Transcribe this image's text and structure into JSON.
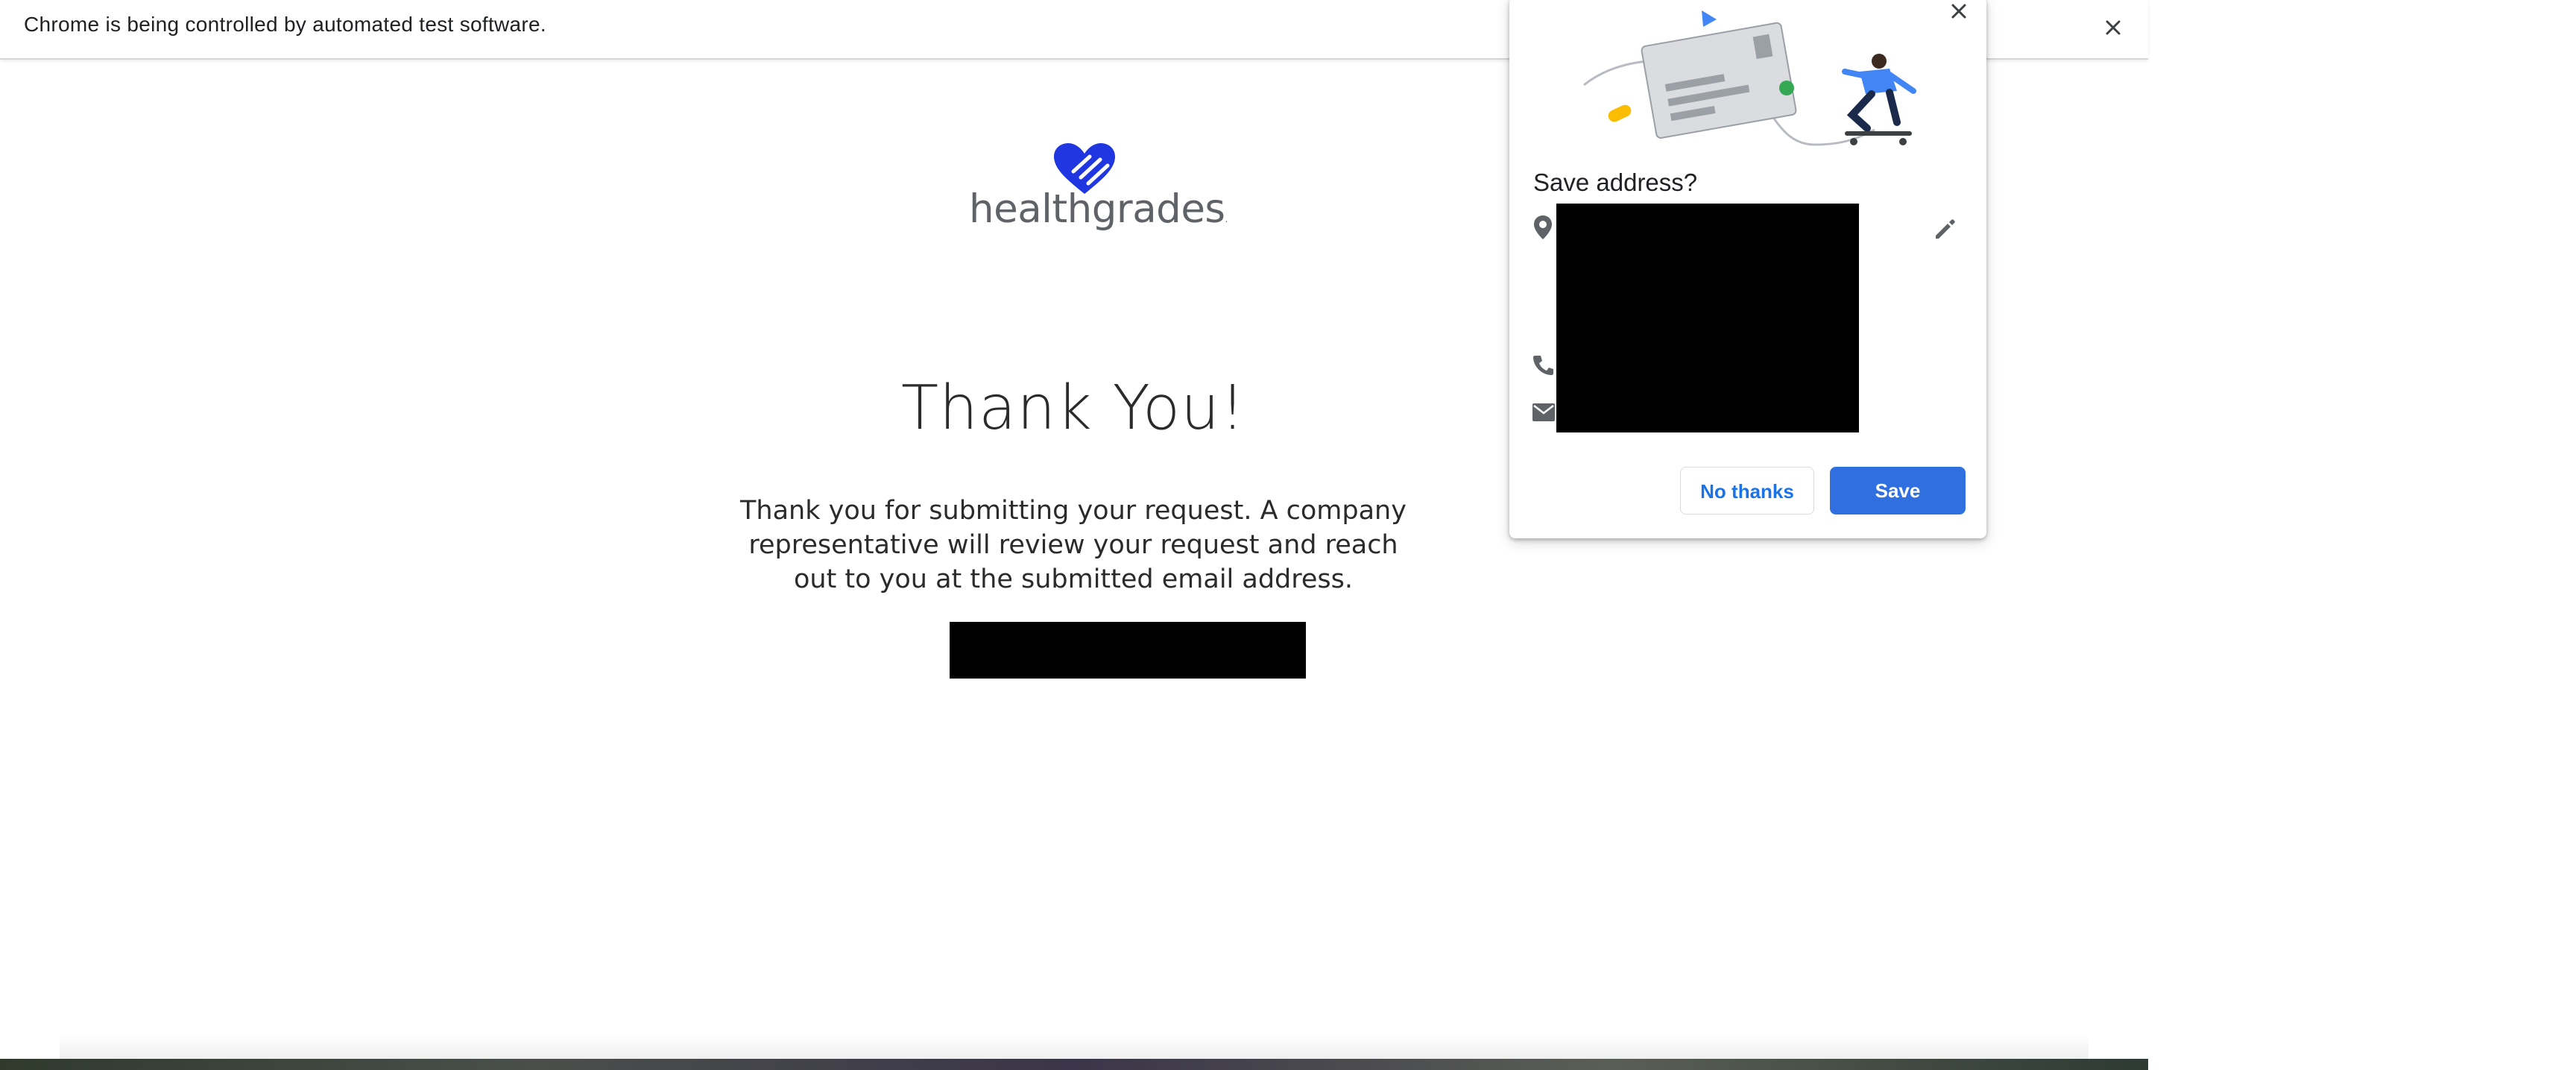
{
  "infobar": {
    "message": "Chrome is being controlled by automated test software.",
    "close_icon": "close-icon"
  },
  "page": {
    "logo_text": "healthgrades",
    "logo_tm": ".",
    "title": "Thank You!",
    "body": "Thank you for submitting your request. A company representative will review your request and reach out to you at the submitted email address."
  },
  "popup": {
    "title": "Save address?",
    "no_thanks_label": "No thanks",
    "save_label": "Save",
    "icons": [
      "location-pin-icon",
      "phone-icon",
      "email-icon",
      "edit-pencil-icon",
      "close-icon"
    ]
  },
  "colors": {
    "brand_blue": "#1f36e0",
    "save_button": "#2f6fe0",
    "link_blue": "#1a73e8"
  }
}
